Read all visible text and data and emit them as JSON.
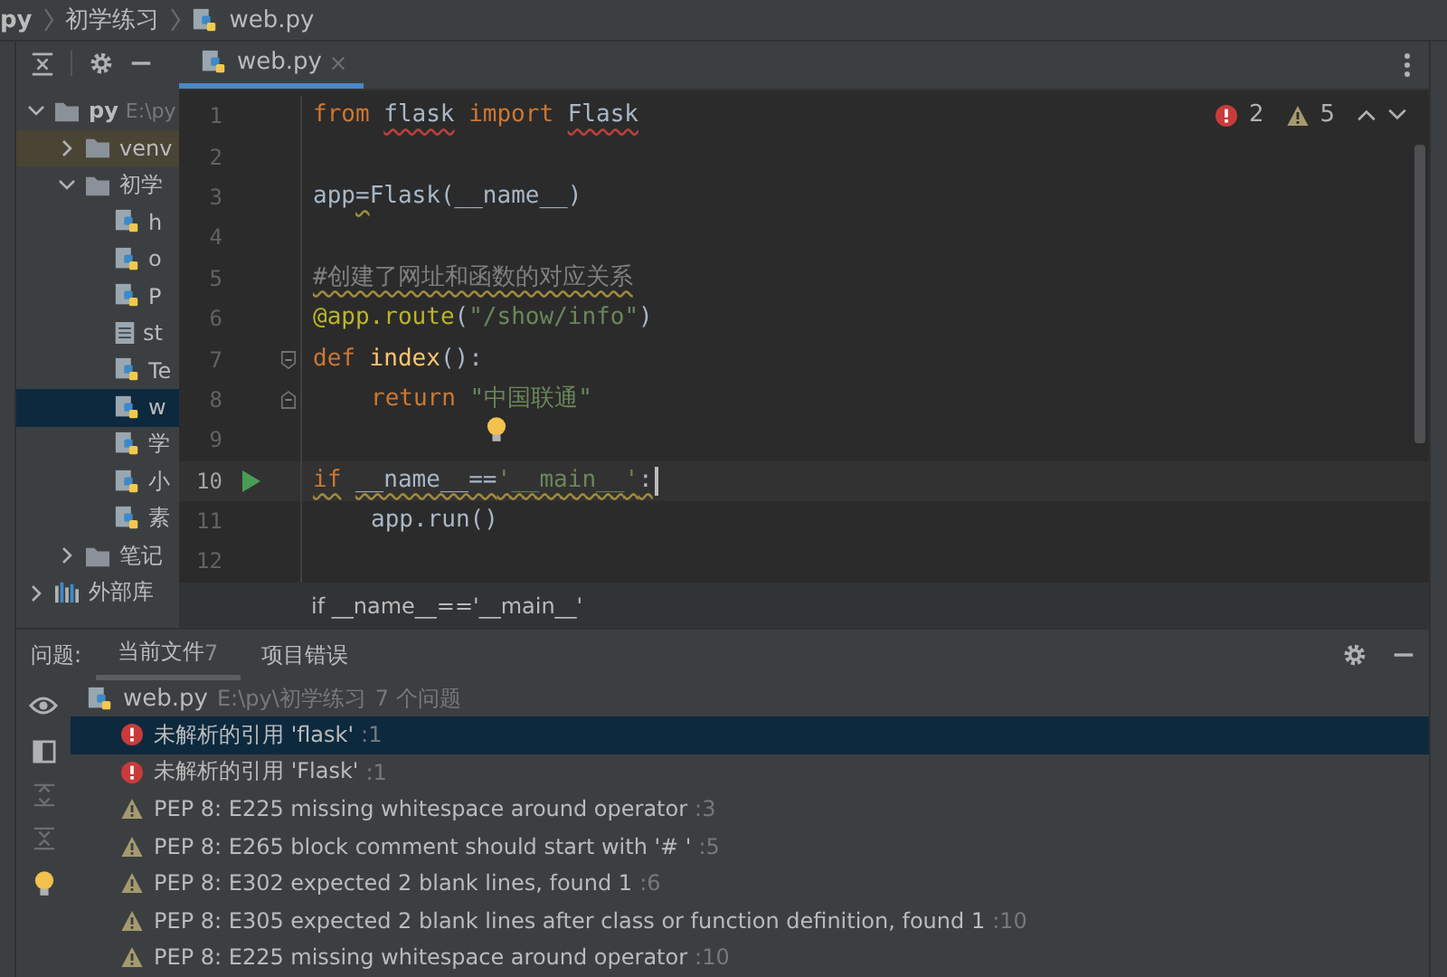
{
  "breadcrumb": [
    {
      "label": "py",
      "kind": "project"
    },
    {
      "label": "初学练习",
      "kind": "folder"
    },
    {
      "label": "web.py",
      "kind": "python"
    }
  ],
  "project_tree": {
    "items": [
      {
        "label": "py",
        "path": "E:\\py",
        "kind": "folder",
        "expanded": true,
        "selected": false,
        "children": [
          {
            "label": "venv",
            "kind": "folder",
            "expanded": false,
            "excluded": true,
            "selected": false
          },
          {
            "label": "初学",
            "kind": "folder",
            "expanded": true,
            "selected": false,
            "children": [
              {
                "label": "h",
                "kind": "python",
                "selected": false
              },
              {
                "label": "o",
                "kind": "python",
                "selected": false
              },
              {
                "label": "P",
                "kind": "python",
                "selected": false
              },
              {
                "label": "st",
                "kind": "text",
                "selected": false
              },
              {
                "label": "Te",
                "kind": "python",
                "selected": false
              },
              {
                "label": "w",
                "kind": "python",
                "selected": true
              },
              {
                "label": "学",
                "kind": "python",
                "selected": false
              },
              {
                "label": "小",
                "kind": "python",
                "selected": false
              },
              {
                "label": "素",
                "kind": "python",
                "selected": false
              }
            ]
          },
          {
            "label": "笔记",
            "kind": "folder",
            "expanded": false,
            "selected": false
          }
        ]
      },
      {
        "label": "外部库",
        "kind": "library",
        "expanded": false,
        "selected": false
      }
    ]
  },
  "editor": {
    "tabs": [
      {
        "label": "web.py",
        "selected": true
      }
    ],
    "errors": "2",
    "warnings": "5",
    "lines": [
      {
        "number": "1",
        "tokens": [
          {
            "t": "from",
            "kind": "keyword"
          },
          {
            "t": "flask",
            "kind": "name",
            "space_before": true,
            "error_mark": true
          },
          {
            "t": "import",
            "kind": "keyword",
            "space_before": true
          },
          {
            "t": "Flask",
            "kind": "name",
            "space_before": true,
            "error_mark": true
          }
        ]
      },
      {
        "number": "2"
      },
      {
        "number": "3",
        "tokens": [
          {
            "t": "app",
            "kind": "name"
          },
          {
            "t": "=",
            "kind": "name",
            "warning_mark": true
          },
          {
            "t": "Flask(__name__)",
            "kind": "name"
          }
        ]
      },
      {
        "number": "4"
      },
      {
        "number": "5",
        "tokens": [
          {
            "t": "#创建了网址和函数的对应关系",
            "kind": "comment",
            "warning_mark": true
          }
        ]
      },
      {
        "number": "6",
        "tokens": [
          {
            "t": "@app.route",
            "kind": "decorator"
          },
          {
            "t": "(",
            "kind": "name"
          },
          {
            "t": "\"/show/info\"",
            "kind": "string"
          },
          {
            "t": ")",
            "kind": "name"
          }
        ]
      },
      {
        "number": "7",
        "fold_start": true,
        "tokens": [
          {
            "t": "def",
            "kind": "keyword"
          },
          {
            "t": "index",
            "kind": "function",
            "space_before": true
          },
          {
            "t": "():",
            "kind": "name"
          }
        ]
      },
      {
        "number": "8",
        "fold_end": true,
        "indented": true,
        "tokens": [
          {
            "t": "return",
            "kind": "keyword"
          },
          {
            "t": "\"中国联通\"",
            "kind": "string",
            "space_before": true
          }
        ]
      },
      {
        "number": "9",
        "bulb": true
      },
      {
        "number": "10",
        "run": true,
        "current": true,
        "tokens": [
          {
            "t": "if",
            "kind": "keyword",
            "warning_mark": true
          },
          {
            "t": "__name__==",
            "kind": "name",
            "space_before": true,
            "warning_mark": true
          },
          {
            "t": "'__main__'",
            "kind": "string",
            "warning_mark": true
          },
          {
            "t": ":",
            "kind": "name",
            "warning_mark": true
          }
        ]
      },
      {
        "number": "11",
        "indented": true,
        "tokens": [
          {
            "t": "app.run()",
            "kind": "name"
          }
        ]
      },
      {
        "number": "12"
      }
    ],
    "context_breadcrumb": "if __name__=='__main__'"
  },
  "problems": {
    "title": "问题:",
    "tabs": [
      {
        "label": "当前文件",
        "count": "7",
        "selected": true
      },
      {
        "label": "项目错误",
        "selected": false
      }
    ],
    "file": {
      "name": "web.py",
      "path": "E:\\py\\初学练习",
      "count": "7 个问题"
    },
    "rows": [
      {
        "kind": "error",
        "message": "未解析的引用 'flask'",
        "line": ":1",
        "selected": true
      },
      {
        "kind": "error",
        "message": "未解析的引用 'Flask'",
        "line": ":1",
        "selected": false
      },
      {
        "kind": "warning",
        "message": "PEP 8: E225 missing whitespace around operator",
        "line": ":3",
        "selected": false
      },
      {
        "kind": "warning",
        "message": "PEP 8: E265 block comment should start with '# '",
        "line": ":5",
        "selected": false
      },
      {
        "kind": "warning",
        "message": "PEP 8: E302 expected 2 blank lines, found 1",
        "line": ":6",
        "selected": false
      },
      {
        "kind": "warning",
        "message": "PEP 8: E305 expected 2 blank lines after class or function definition, found 1",
        "line": ":10",
        "selected": false
      },
      {
        "kind": "warning",
        "message": "PEP 8: E225 missing whitespace around operator",
        "line": ":10",
        "selected": false
      }
    ]
  }
}
